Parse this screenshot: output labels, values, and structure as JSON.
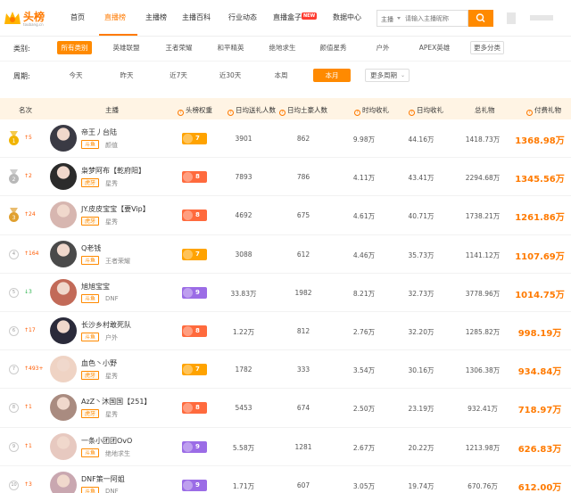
{
  "site": {
    "logo_title": "头榜",
    "logo_sub": "toubang.cn"
  },
  "nav": {
    "items": [
      "首页",
      "直播榜",
      "主播榜",
      "主播百科",
      "行业动态",
      "直播盒子",
      "数据中心"
    ],
    "active_index": 1,
    "new_badge": "NEW"
  },
  "search": {
    "select_value": "主播",
    "placeholder": "请输入主播昵称"
  },
  "filters": {
    "category_label": "类别:",
    "categories": [
      "所有类别",
      "英雄联盟",
      "王者荣耀",
      "和平精英",
      "绝地求生",
      "颜值星秀",
      "户外",
      "APEX英雄",
      "更多分类"
    ],
    "category_active_index": 0,
    "period_label": "周期:",
    "periods": [
      "今天",
      "昨天",
      "近7天",
      "近30天",
      "本周",
      "本月",
      "更多周期"
    ],
    "period_active_index": 5
  },
  "table": {
    "headers": {
      "rank": "名次",
      "streamer": "主播",
      "weight": "头榜权重",
      "daily_gift_users": "日均送礼人数",
      "daily_active_users": "日均土豪人数",
      "sweet_gift": "时均收礼",
      "daily_gift": "日均收礼",
      "total_gift": "总礼物",
      "paid_gift": "付费礼物"
    },
    "rows": [
      {
        "rank": "1",
        "trend": "↑5",
        "trend_dir": "up",
        "name": "帝王丿台陆",
        "platform": "斗鱼",
        "category": "颜值",
        "weight": "7",
        "weight_color": "yellow",
        "gift_users": "3901",
        "tuhao": "862",
        "hourly": "9.98万",
        "daily": "44.16万",
        "total": "1418.73万",
        "paid": "1368.98万"
      },
      {
        "rank": "2",
        "trend": "↑2",
        "trend_dir": "up",
        "name": "枭梦阿布【乾府阳】",
        "platform": "虎牙",
        "category": "星秀",
        "weight": "8",
        "weight_color": "orange",
        "gift_users": "7893",
        "tuhao": "786",
        "hourly": "4.11万",
        "daily": "43.41万",
        "total": "2294.68万",
        "paid": "1345.56万"
      },
      {
        "rank": "3",
        "trend": "↑24",
        "trend_dir": "up",
        "name": "JY.皮皮宝宝【要Vip】",
        "platform": "虎牙",
        "category": "星秀",
        "weight": "8",
        "weight_color": "orange",
        "gift_users": "4692",
        "tuhao": "675",
        "hourly": "4.61万",
        "daily": "40.71万",
        "total": "1738.21万",
        "paid": "1261.86万"
      },
      {
        "rank": "4",
        "trend": "↑164",
        "trend_dir": "up",
        "name": "Q老钱",
        "platform": "斗鱼",
        "category": "王者荣耀",
        "weight": "7",
        "weight_color": "yellow",
        "gift_users": "3088",
        "tuhao": "612",
        "hourly": "4.46万",
        "daily": "35.73万",
        "total": "1141.12万",
        "paid": "1107.69万"
      },
      {
        "rank": "5",
        "trend": "↓3",
        "trend_dir": "down",
        "name": "旭旭宝宝",
        "platform": "斗鱼",
        "category": "DNF",
        "weight": "9",
        "weight_color": "purple",
        "gift_users": "33.83万",
        "tuhao": "1982",
        "hourly": "8.21万",
        "daily": "32.73万",
        "total": "3778.96万",
        "paid": "1014.75万"
      },
      {
        "rank": "6",
        "trend": "↑17",
        "trend_dir": "up",
        "name": "长沙乡村敢死队",
        "platform": "斗鱼",
        "category": "户外",
        "weight": "8",
        "weight_color": "orange",
        "gift_users": "1.22万",
        "tuhao": "812",
        "hourly": "2.76万",
        "daily": "32.20万",
        "total": "1285.82万",
        "paid": "998.19万"
      },
      {
        "rank": "7",
        "trend": "↑493+",
        "trend_dir": "up",
        "name": "血色丶小野",
        "platform": "虎牙",
        "category": "星秀",
        "weight": "7",
        "weight_color": "yellow",
        "gift_users": "1782",
        "tuhao": "333",
        "hourly": "3.54万",
        "daily": "30.16万",
        "total": "1306.38万",
        "paid": "934.84万"
      },
      {
        "rank": "8",
        "trend": "↑1",
        "trend_dir": "up",
        "name": "AzZ丶沐国国【251】",
        "platform": "虎牙",
        "category": "星秀",
        "weight": "8",
        "weight_color": "orange",
        "gift_users": "5453",
        "tuhao": "674",
        "hourly": "2.50万",
        "daily": "23.19万",
        "total": "932.41万",
        "paid": "718.97万"
      },
      {
        "rank": "9",
        "trend": "↑1",
        "trend_dir": "up",
        "name": "一条小团团OvO",
        "platform": "斗鱼",
        "category": "绝地求生",
        "weight": "9",
        "weight_color": "purple",
        "gift_users": "5.58万",
        "tuhao": "1281",
        "hourly": "2.67万",
        "daily": "20.22万",
        "total": "1213.98万",
        "paid": "626.83万"
      },
      {
        "rank": "10",
        "trend": "↑3",
        "trend_dir": "up",
        "name": "DNF策一阿姐",
        "platform": "斗鱼",
        "category": "DNF",
        "weight": "9",
        "weight_color": "purple",
        "gift_users": "1.71万",
        "tuhao": "607",
        "hourly": "3.05万",
        "daily": "19.74万",
        "total": "670.76万",
        "paid": "612.00万"
      }
    ]
  },
  "colors": {
    "accent": "#ff7a00",
    "header_bg": "#fff4e4",
    "weight_yellow": "#ffa300",
    "weight_orange": "#ff6a3d",
    "weight_purple": "#9b6ce6",
    "trend_up": "#ff5a00",
    "trend_down": "#2bb24c"
  }
}
